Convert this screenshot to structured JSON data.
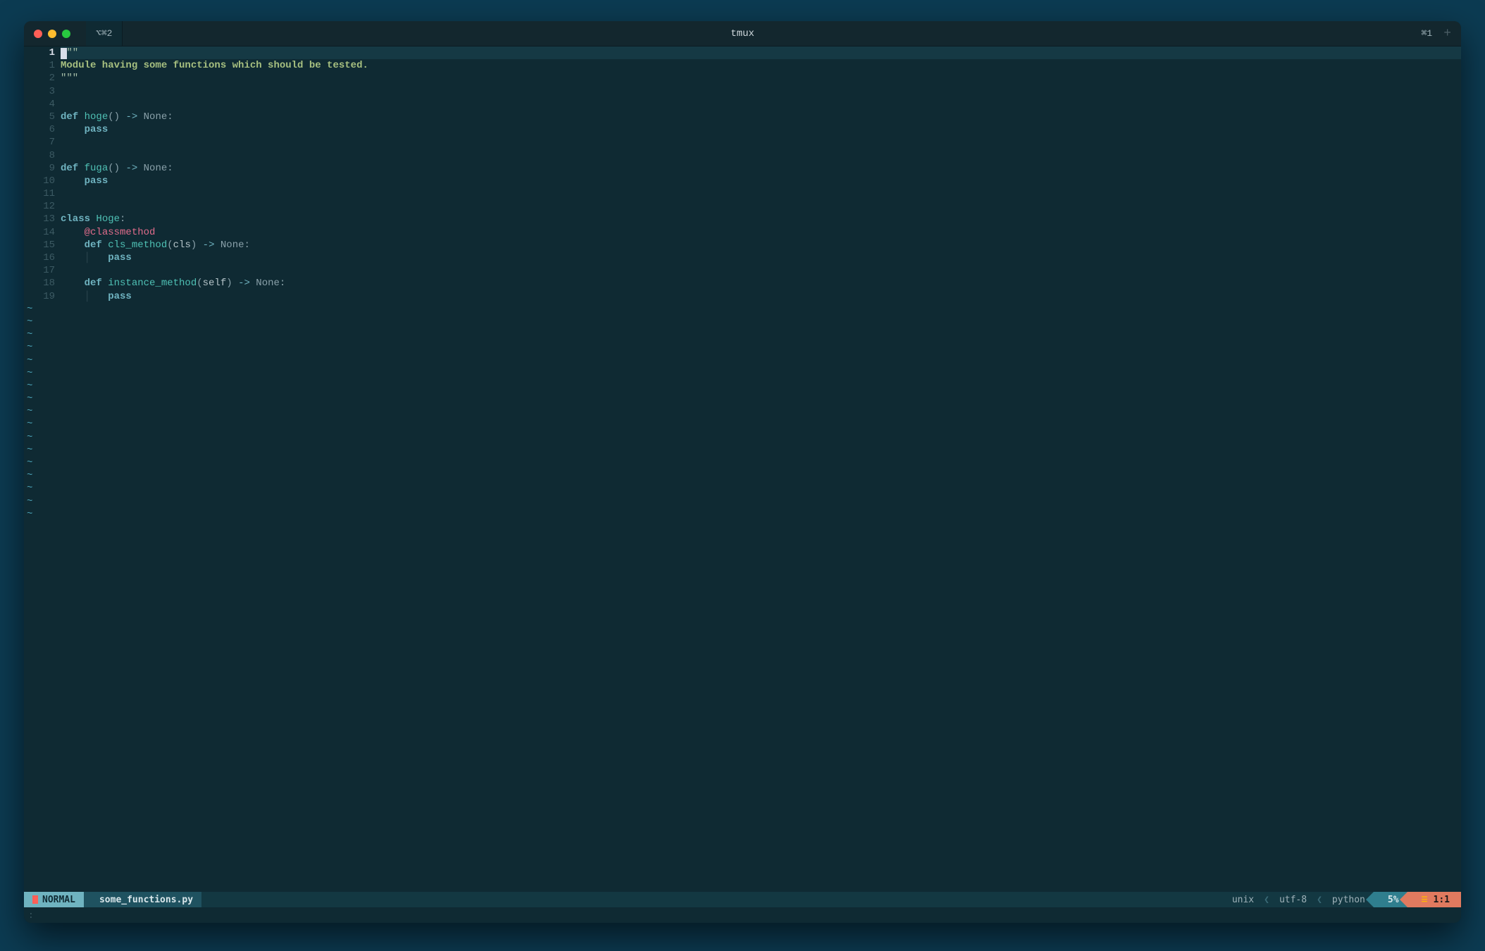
{
  "titlebar": {
    "title": "tmux",
    "tab_label": "⌥⌘2",
    "right_label": "⌘1"
  },
  "editor": {
    "current_line_abs": "1",
    "tilde_rows": 17,
    "lines": [
      {
        "rel": "",
        "is_current": true,
        "tokens": [
          {
            "cursor": true
          },
          {
            "cls": "doc",
            "t": "\"\"\""
          }
        ]
      },
      {
        "rel": "1",
        "tokens": [
          {
            "cls": "docbody",
            "t": "Module having some functions which should be tested."
          }
        ]
      },
      {
        "rel": "2",
        "tokens": [
          {
            "cls": "doc",
            "t": "\"\"\""
          }
        ]
      },
      {
        "rel": "3",
        "tokens": []
      },
      {
        "rel": "4",
        "tokens": []
      },
      {
        "rel": "5",
        "tokens": [
          {
            "cls": "kw",
            "t": "def "
          },
          {
            "cls": "fn",
            "t": "hoge"
          },
          {
            "cls": "punct",
            "t": "() "
          },
          {
            "cls": "arrow",
            "t": "->"
          },
          {
            "cls": "type",
            "t": " None"
          },
          {
            "cls": "punct",
            "t": ":"
          }
        ]
      },
      {
        "rel": "6",
        "tokens": [
          {
            "t": "    "
          },
          {
            "cls": "kw",
            "t": "pass"
          }
        ]
      },
      {
        "rel": "7",
        "tokens": []
      },
      {
        "rel": "8",
        "tokens": []
      },
      {
        "rel": "9",
        "tokens": [
          {
            "cls": "kw",
            "t": "def "
          },
          {
            "cls": "fn",
            "t": "fuga"
          },
          {
            "cls": "punct",
            "t": "() "
          },
          {
            "cls": "arrow",
            "t": "->"
          },
          {
            "cls": "type",
            "t": " None"
          },
          {
            "cls": "punct",
            "t": ":"
          }
        ]
      },
      {
        "rel": "10",
        "tokens": [
          {
            "t": "    "
          },
          {
            "cls": "kw",
            "t": "pass"
          }
        ]
      },
      {
        "rel": "11",
        "tokens": []
      },
      {
        "rel": "12",
        "tokens": []
      },
      {
        "rel": "13",
        "tokens": [
          {
            "cls": "kw",
            "t": "class "
          },
          {
            "cls": "fn",
            "t": "Hoge"
          },
          {
            "cls": "punct",
            "t": ":"
          }
        ]
      },
      {
        "rel": "14",
        "tokens": [
          {
            "t": "    "
          },
          {
            "cls": "deco",
            "t": "@classmethod"
          }
        ]
      },
      {
        "rel": "15",
        "tokens": [
          {
            "t": "    "
          },
          {
            "cls": "kw",
            "t": "def "
          },
          {
            "cls": "fn",
            "t": "cls_method"
          },
          {
            "cls": "punct",
            "t": "("
          },
          {
            "cls": "param",
            "t": "cls"
          },
          {
            "cls": "punct",
            "t": ") "
          },
          {
            "cls": "arrow",
            "t": "->"
          },
          {
            "cls": "type",
            "t": " None"
          },
          {
            "cls": "punct",
            "t": ":"
          }
        ]
      },
      {
        "rel": "16",
        "tokens": [
          {
            "t": "    "
          },
          {
            "cls": "indent-guide",
            "t": "│   "
          },
          {
            "cls": "kw",
            "t": "pass"
          }
        ]
      },
      {
        "rel": "17",
        "tokens": []
      },
      {
        "rel": "18",
        "tokens": [
          {
            "t": "    "
          },
          {
            "cls": "kw",
            "t": "def "
          },
          {
            "cls": "fn",
            "t": "instance_method"
          },
          {
            "cls": "punct",
            "t": "("
          },
          {
            "cls": "param",
            "t": "self"
          },
          {
            "cls": "punct",
            "t": ") "
          },
          {
            "cls": "arrow",
            "t": "->"
          },
          {
            "cls": "type",
            "t": " None"
          },
          {
            "cls": "punct",
            "t": ":"
          }
        ]
      },
      {
        "rel": "19",
        "tokens": [
          {
            "t": "    "
          },
          {
            "cls": "indent-guide",
            "t": "│   "
          },
          {
            "cls": "kw",
            "t": "pass"
          }
        ]
      }
    ]
  },
  "statusbar": {
    "mode": "NORMAL",
    "filename": "some_functions.py",
    "fileformat": "unix",
    "encoding": "utf-8",
    "filetype": "python",
    "percent": "5%",
    "position": "1:1"
  },
  "cmdline": ":"
}
